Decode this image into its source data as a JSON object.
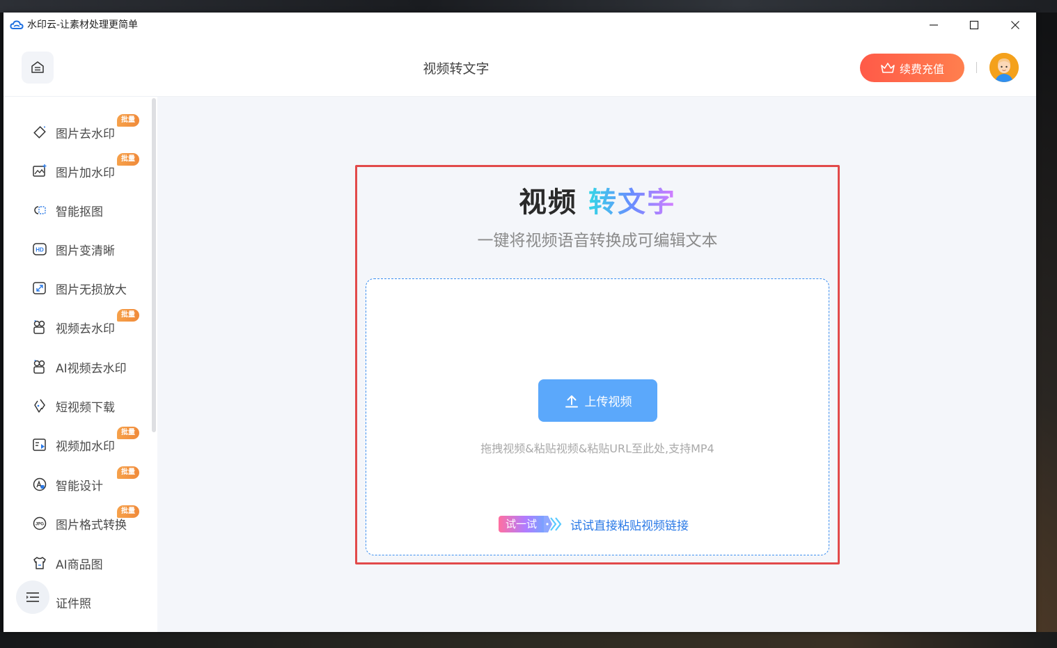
{
  "window": {
    "title": "水印云-让素材处理更简单"
  },
  "header": {
    "page_title": "视频转文字",
    "vip_label": "续费充值"
  },
  "sidebar": {
    "items": [
      {
        "label": "图片去水印",
        "icon": "eraser-icon",
        "badge": "批量"
      },
      {
        "label": "图片加水印",
        "icon": "image-add-icon",
        "badge": "批量"
      },
      {
        "label": "智能抠图",
        "icon": "cutout-icon",
        "badge": ""
      },
      {
        "label": "图片变清晰",
        "icon": "hd-icon",
        "badge": ""
      },
      {
        "label": "图片无损放大",
        "icon": "enlarge-icon",
        "badge": ""
      },
      {
        "label": "视频去水印",
        "icon": "video-erase-icon",
        "badge": "批量"
      },
      {
        "label": "AI视频去水印",
        "icon": "ai-video-erase-icon",
        "badge": ""
      },
      {
        "label": "短视频下载",
        "icon": "link-download-icon",
        "badge": ""
      },
      {
        "label": "视频加水印",
        "icon": "video-add-icon",
        "badge": "批量"
      },
      {
        "label": "智能设计",
        "icon": "design-icon",
        "badge": "批量"
      },
      {
        "label": "图片格式转换",
        "icon": "format-convert-icon",
        "badge": "批量"
      },
      {
        "label": "AI商品图",
        "icon": "shirt-icon",
        "badge": ""
      },
      {
        "label": "证件照",
        "icon": "id-photo-icon",
        "badge": ""
      }
    ]
  },
  "hero": {
    "title_part1": "视频",
    "title_part2": "转文字",
    "subtitle": "一键将视频语音转换成可编辑文本",
    "upload_label": "上传视频",
    "drop_hint": "拖拽视频&粘贴视频&粘贴URL至此处,支持MP4",
    "try_badge": "试一试",
    "try_link": "试试直接粘贴视频链接"
  },
  "colors": {
    "accent": "#5ba8fb",
    "vip_start": "#ff5a48",
    "vip_end": "#ff7f4e",
    "badge": "#f39546",
    "frame": "#e24a4a",
    "link": "#2a79e6"
  }
}
